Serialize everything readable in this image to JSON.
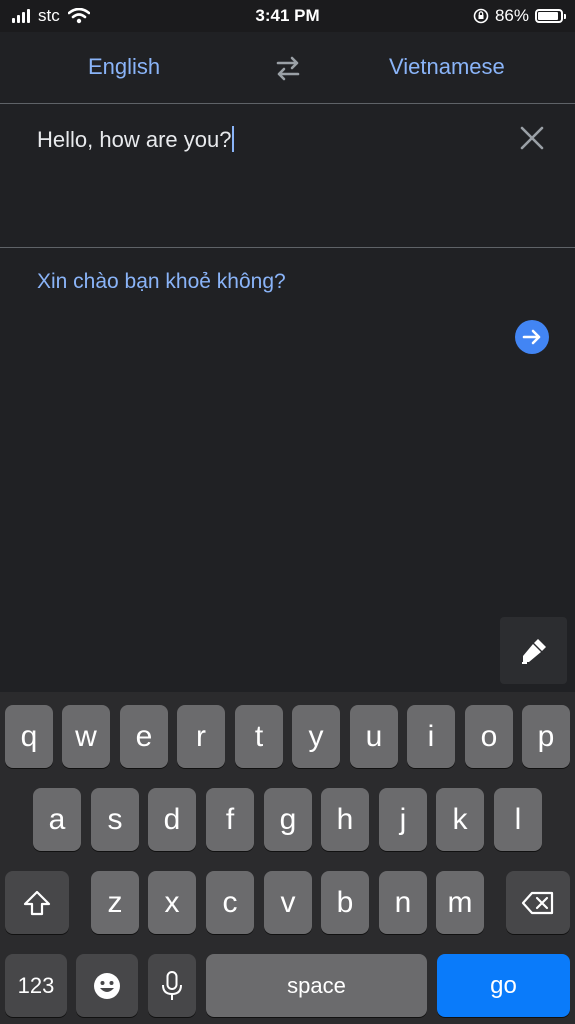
{
  "status_bar": {
    "carrier": "stc",
    "time": "3:41 PM",
    "battery": "86%"
  },
  "languages": {
    "source": "English",
    "target": "Vietnamese"
  },
  "input": {
    "text": "Hello, how are you?"
  },
  "output": {
    "text": "Xin chào bạn khoẻ không?"
  },
  "icons": {
    "swap": "swap-arrows-icon",
    "clear": "close-icon",
    "submit": "arrow-right-icon",
    "handwriting": "pen-icon",
    "shift": "shift-icon",
    "backspace": "backspace-icon",
    "emoji": "emoji-icon",
    "mic": "microphone-icon"
  },
  "keyboard": {
    "row1": [
      "q",
      "w",
      "e",
      "r",
      "t",
      "y",
      "u",
      "i",
      "o",
      "p"
    ],
    "row2": [
      "a",
      "s",
      "d",
      "f",
      "g",
      "h",
      "j",
      "k",
      "l"
    ],
    "row3": [
      "z",
      "x",
      "c",
      "v",
      "b",
      "n",
      "m"
    ],
    "numbers_label": "123",
    "space_label": "space",
    "go_label": "go"
  },
  "colors": {
    "accent": "#8ab4f8",
    "background": "#202124",
    "go_key": "#0a7bfa",
    "submit_circle": "#4285f4"
  }
}
